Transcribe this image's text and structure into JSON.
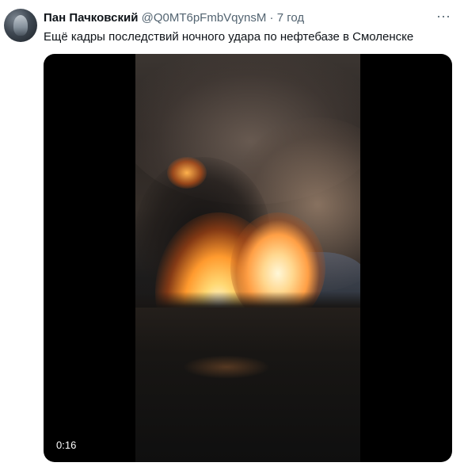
{
  "tweet": {
    "author_name": "Пан Пачковский",
    "handle": "@Q0MT6pFmbVqynsM",
    "separator": "·",
    "time": "7 год",
    "more_icon": "more-horizontal-icon",
    "text": "Ещё кадры последствий ночного удара по нефтебазе в Смоленске",
    "video": {
      "duration": "0:16"
    }
  }
}
